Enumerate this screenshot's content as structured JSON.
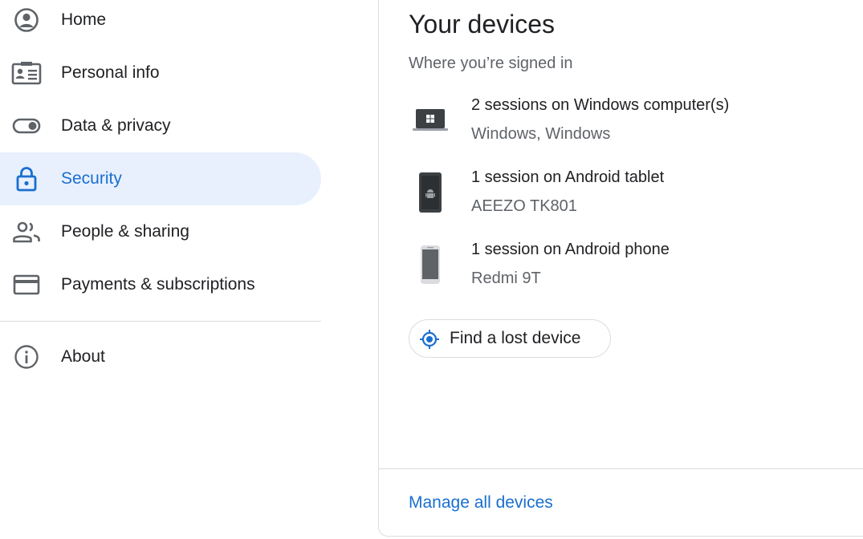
{
  "sidebar": {
    "items": [
      {
        "label": "Home",
        "icon": "account-circle-icon",
        "active": false
      },
      {
        "label": "Personal info",
        "icon": "id-card-icon",
        "active": false
      },
      {
        "label": "Data & privacy",
        "icon": "toggle-icon",
        "active": false
      },
      {
        "label": "Security",
        "icon": "lock-icon",
        "active": true
      },
      {
        "label": "People & sharing",
        "icon": "people-icon",
        "active": false
      },
      {
        "label": "Payments & subscriptions",
        "icon": "credit-card-icon",
        "active": false
      },
      {
        "label": "About",
        "icon": "info-icon",
        "active": false
      }
    ]
  },
  "devices_card": {
    "title": "Your devices",
    "subtitle": "Where you’re signed in",
    "devices": [
      {
        "title": "2 sessions on Windows computer(s)",
        "detail": "Windows, Windows",
        "icon": "windows-laptop-icon"
      },
      {
        "title": "1 session on Android tablet",
        "detail": "AEEZO TK801",
        "icon": "android-tablet-icon"
      },
      {
        "title": "1 session on Android phone",
        "detail": "Redmi 9T",
        "icon": "android-phone-icon"
      }
    ],
    "find_button": {
      "label": "Find a lost device",
      "icon": "location-target-icon"
    },
    "manage_link": "Manage all devices"
  },
  "colors": {
    "accent": "#1a6fcf",
    "active_bg": "#e8f0fe",
    "text_primary": "#202124",
    "text_secondary": "#5f6368",
    "divider": "#dadce0"
  }
}
